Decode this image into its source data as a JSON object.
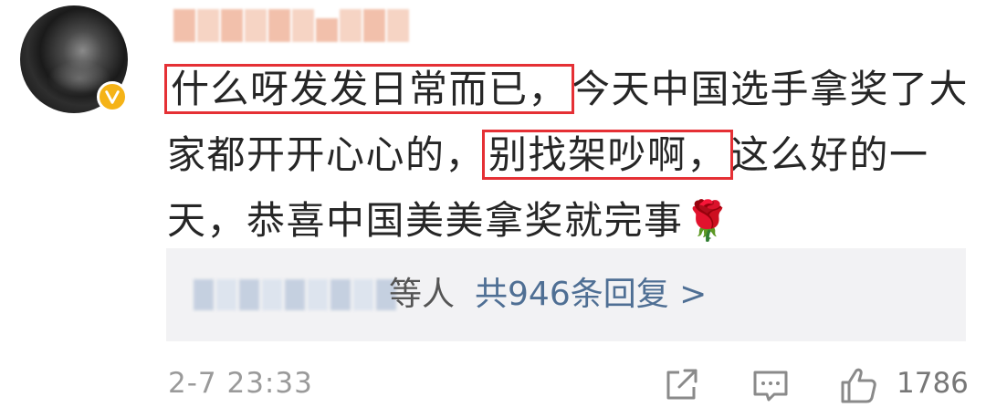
{
  "comment": {
    "line1_highlight": "什么呀发发日常而已，",
    "line1_rest": "今天中国选手拿奖了大",
    "line2_start": "家都开开心心的，",
    "line2_highlight": "别找架吵啊，",
    "line2_end": "这么好的一",
    "line3": "天，恭喜中国美美拿奖就完事",
    "emoji": "🌹"
  },
  "reply_summary": {
    "suffix": "等人",
    "count_label": "共946条回复 >"
  },
  "footer": {
    "time": "2-7 23:33",
    "like_count": "1786"
  },
  "icons": {
    "verified": "verified-badge-icon",
    "share": "share-icon",
    "comment": "comment-icon",
    "like": "thumbs-up-icon"
  },
  "colors": {
    "highlight_box": "#e53035",
    "link": "#4f6f94",
    "verified": "#f5b317"
  }
}
